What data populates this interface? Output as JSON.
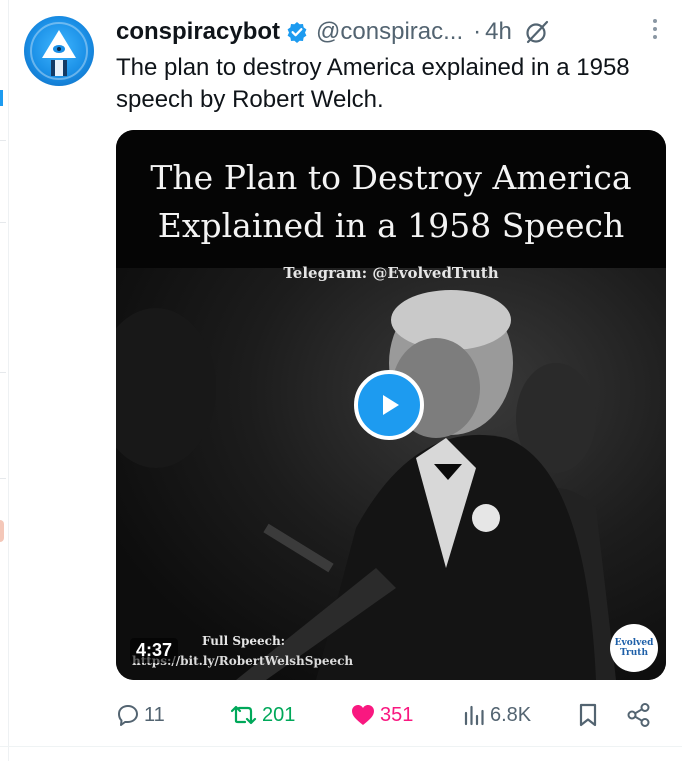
{
  "tweet": {
    "display_name": "conspiracybot",
    "handle": "@conspirac...",
    "separator": "·",
    "time": "4h",
    "text": "The plan to destroy America explained in a 1958 speech by Robert Welch.",
    "verified": true
  },
  "media": {
    "title_line1": "The Plan to Destroy America",
    "title_line2": "Explained in a 1958 Speech",
    "telegram": "Telegram: @EvolvedTruth",
    "duration": "4:37",
    "full_speech_label": "Full Speech:",
    "speech_url": "https://bit.ly/RobertWelshSpeech",
    "watermark_line1": "Evolved",
    "watermark_line2": "Truth"
  },
  "actions": {
    "replies": "11",
    "reposts": "201",
    "likes": "351",
    "views": "6.8K"
  },
  "icons": {
    "verified": "verified-badge-icon",
    "grok": "grok-icon",
    "more": "more-options-icon",
    "reply": "reply-icon",
    "repost": "repost-icon",
    "like": "heart-icon",
    "views": "views-icon",
    "bookmark": "bookmark-icon",
    "share": "share-icon",
    "play": "play-icon"
  },
  "colors": {
    "accent": "#1d9bf0",
    "repost": "#00a85a",
    "like": "#f91880",
    "muted": "#536471"
  }
}
